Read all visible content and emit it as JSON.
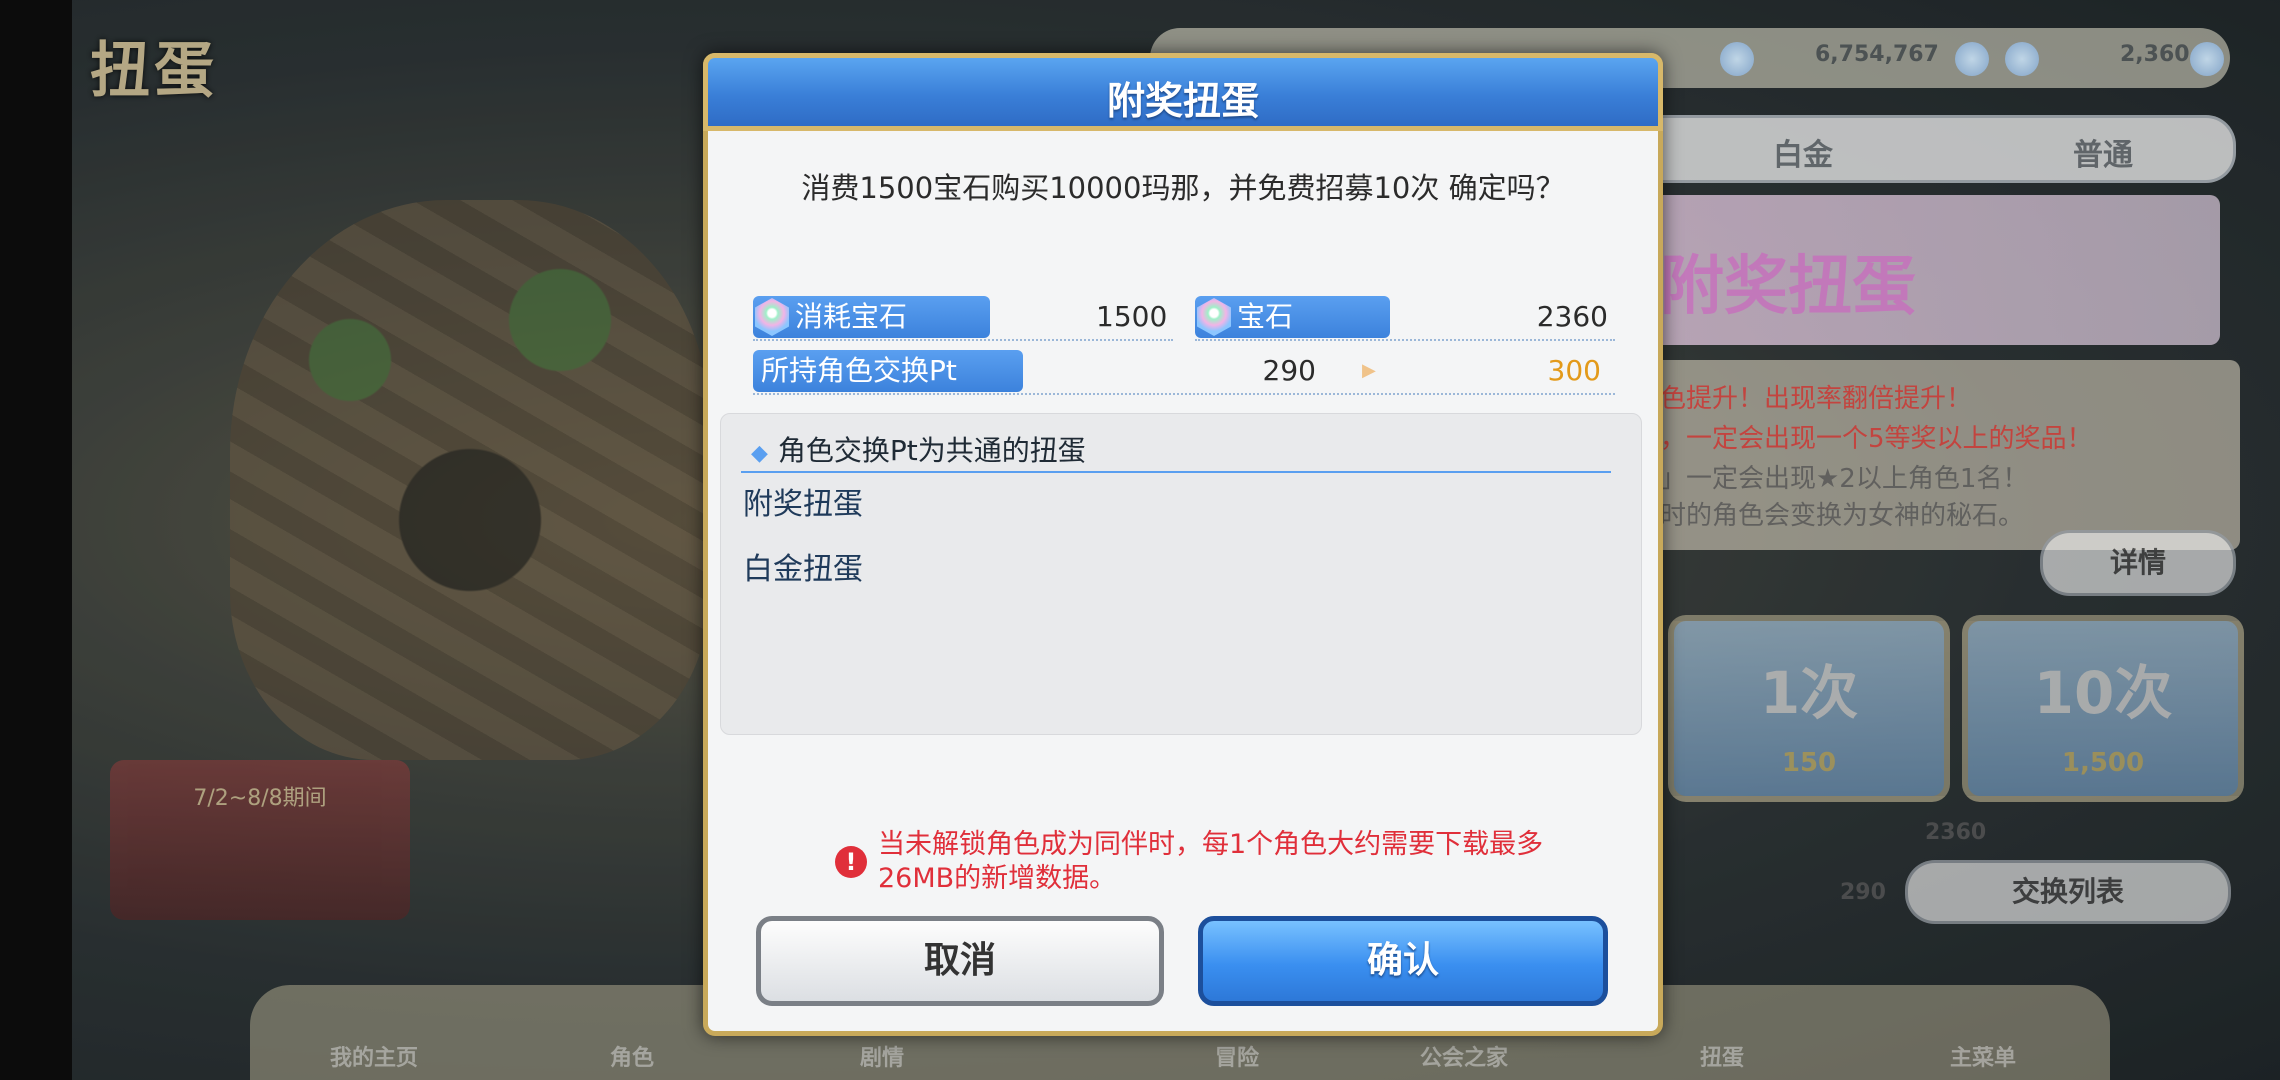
{
  "background": {
    "screen_title": "扭蛋",
    "event_banner": "7/2~8/8期间",
    "resources": {
      "amount1": "6,754,767",
      "amount2": "2,360"
    },
    "tabs": [
      "白金",
      "普通"
    ],
    "banner_title": "附奖扭蛋",
    "banner_lines": [
      "色提升！出现率翻倍提升！",
      "，一定会出现一个5等奖以上的奖品！",
      "」一定会出现★2以上角色1名！",
      "时的角色会变换为女神的秘石。"
    ],
    "detail_button": "详情",
    "gacha_1": {
      "label": "1次",
      "cost": "150"
    },
    "gacha_10": {
      "label": "10次",
      "cost": "1,500"
    },
    "side_values": [
      "2360",
      "290"
    ],
    "exchange_button": "交换列表",
    "nav": [
      "我的主页",
      "角色",
      "剧情",
      "冒险",
      "公会之家",
      "扭蛋",
      "主菜单"
    ]
  },
  "dialog": {
    "title": "附奖扭蛋",
    "question": "消费1500宝石购买10000玛那，并免费招募10次 确定吗？",
    "stats": {
      "cost_label": "消耗宝石",
      "cost_value": "1500",
      "gem_label": "宝石",
      "gem_value": "2360",
      "pt_label": "所持角色交换Pt",
      "pt_before": "290",
      "pt_after": "300"
    },
    "info": {
      "heading": "角色交换Pt为共通的扭蛋",
      "items": [
        "附奖扭蛋",
        "白金扭蛋"
      ]
    },
    "warning": "当未解锁角色成为同伴时，每1个角色大约需要下载最多26MB的新增数据。",
    "buttons": {
      "cancel": "取消",
      "confirm": "确认"
    }
  },
  "colors": {
    "header_blue": "#3a7fd8",
    "gold_border": "#c8a95a",
    "warning_red": "#e02f3a",
    "pt_after_orange": "#e39a1a"
  },
  "icons": [
    "gem-icon",
    "warning-icon",
    "diamond-bullet-icon",
    "arrow-right-icon"
  ]
}
